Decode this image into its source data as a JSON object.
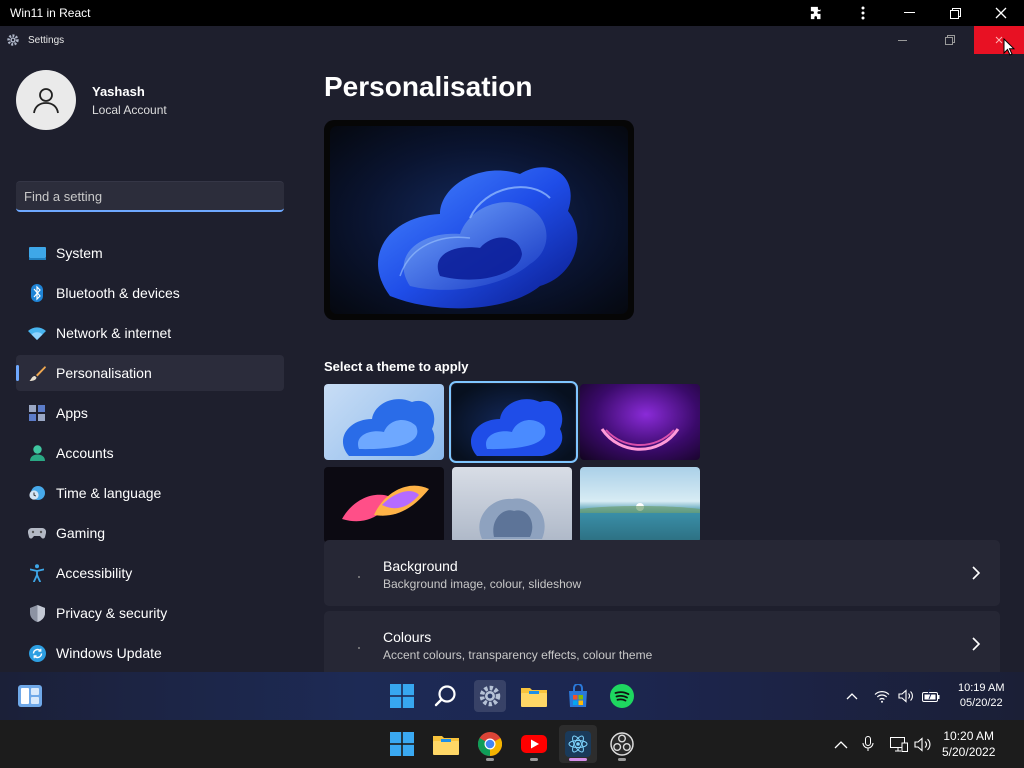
{
  "browser": {
    "title": "Win11 in React"
  },
  "settings": {
    "window_title": "Settings",
    "profile": {
      "name": "Yashash",
      "account_type": "Local Account"
    },
    "search_placeholder": "Find a setting",
    "nav": [
      {
        "label": "System",
        "icon": "system-icon"
      },
      {
        "label": "Bluetooth & devices",
        "icon": "bluetooth-icon"
      },
      {
        "label": "Network & internet",
        "icon": "wifi-icon"
      },
      {
        "label": "Personalisation",
        "icon": "brush-icon"
      },
      {
        "label": "Apps",
        "icon": "apps-icon"
      },
      {
        "label": "Accounts",
        "icon": "accounts-icon"
      },
      {
        "label": "Time & language",
        "icon": "clock-globe-icon"
      },
      {
        "label": "Gaming",
        "icon": "gamepad-icon"
      },
      {
        "label": "Accessibility",
        "icon": "accessibility-icon"
      },
      {
        "label": "Privacy & security",
        "icon": "shield-icon"
      },
      {
        "label": "Windows Update",
        "icon": "update-icon"
      }
    ],
    "active_nav": "Personalisation",
    "page_title": "Personalisation",
    "theme_heading": "Select a theme to apply",
    "themes": [
      {
        "name": "windows-light-bloom"
      },
      {
        "name": "windows-dark-bloom",
        "selected": true
      },
      {
        "name": "glow"
      },
      {
        "name": "captured-motion"
      },
      {
        "name": "sunrise-flow"
      },
      {
        "name": "lake"
      }
    ],
    "cards": [
      {
        "title": "Background",
        "subtitle": "Background image, colour, slideshow"
      },
      {
        "title": "Colours",
        "subtitle": "Accent colours, transparency effects, colour theme"
      }
    ]
  },
  "inner_taskbar": {
    "time": "10:19 AM",
    "date": "05/20/22"
  },
  "host_taskbar": {
    "time": "10:20 AM",
    "date": "5/20/2022"
  },
  "colors": {
    "accent": "#6ea8ff",
    "close_red": "#e81123",
    "window_bg": "#1e1f2d",
    "card_bg": "#262735"
  }
}
